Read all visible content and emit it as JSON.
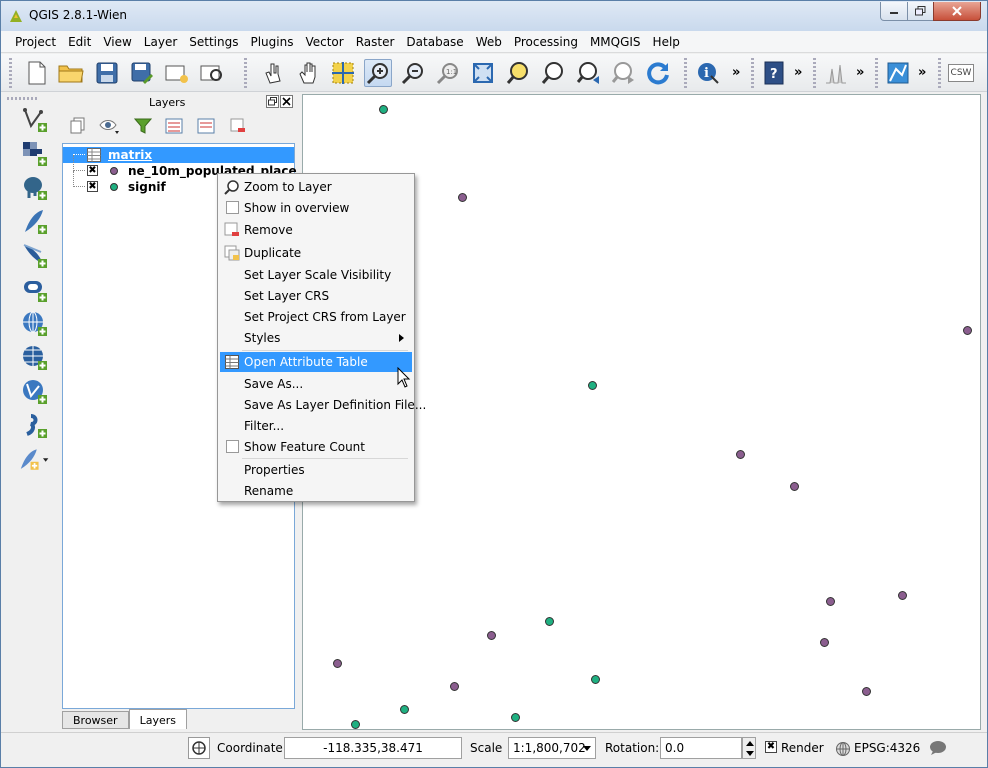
{
  "window": {
    "title": "QGIS 2.8.1-Wien"
  },
  "menubar": {
    "items": [
      "Project",
      "Edit",
      "View",
      "Layer",
      "Settings",
      "Plugins",
      "Vector",
      "Raster",
      "Database",
      "Web",
      "Processing",
      "MMQGIS",
      "Help"
    ]
  },
  "toolbar": {
    "csw_label": "CSW",
    "more_label": "»"
  },
  "layers_panel": {
    "title": "Layers",
    "layers": [
      {
        "name": "matrix",
        "type": "table",
        "selected": true
      },
      {
        "name": "ne_10m_populated_place",
        "type": "point",
        "color": "#8b5e8f",
        "checked": true
      },
      {
        "name": "signif",
        "type": "point",
        "color": "#1fb081",
        "checked": true
      }
    ],
    "tabs": [
      "Browser",
      "Layers"
    ],
    "active_tab": "Layers"
  },
  "context_menu": {
    "items": [
      {
        "label": "Zoom to Layer",
        "icon": "zoom-layer-icon"
      },
      {
        "label": "Show in overview",
        "checkbox": true
      },
      {
        "label": "Remove",
        "icon": "remove-icon"
      },
      {
        "label": "Duplicate",
        "icon": "duplicate-icon"
      },
      {
        "label": "Set Layer Scale Visibility"
      },
      {
        "label": "Set Layer CRS"
      },
      {
        "label": "Set Project CRS from Layer"
      },
      {
        "label": "Styles",
        "submenu": true
      },
      {
        "label": "Open Attribute Table",
        "icon": "table-icon",
        "highlighted": true
      },
      {
        "label": "Save As..."
      },
      {
        "label": "Save As Layer Definition File..."
      },
      {
        "label": "Filter..."
      },
      {
        "label": "Show Feature Count",
        "checkbox": true
      },
      {
        "label": "Properties"
      },
      {
        "label": "Rename"
      }
    ]
  },
  "statusbar": {
    "coordinate_label": "Coordinate:",
    "coordinate_value": "-118.335,38.471",
    "scale_label": "Scale",
    "scale_value": "1:1,800,702",
    "rotation_label": "Rotation:",
    "rotation_value": "0.0",
    "render_label": "Render",
    "render_checked": true,
    "crs_label": "EPSG:4326"
  },
  "colors": {
    "populated_place": "#8b5e8f",
    "signif": "#1fb081",
    "selection": "#3399ff"
  }
}
